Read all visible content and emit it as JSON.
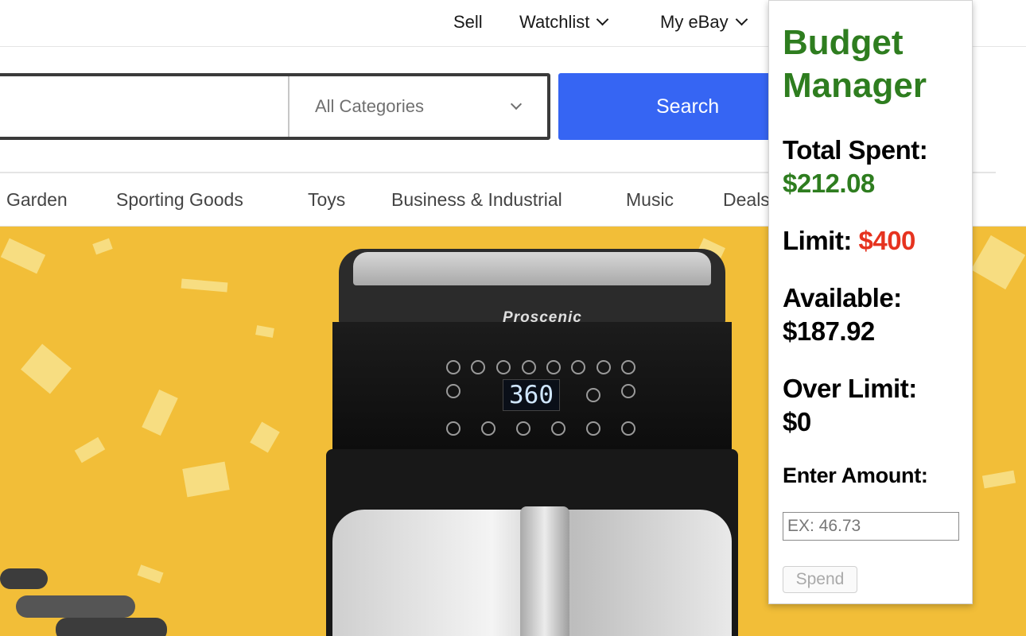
{
  "header": {
    "nav": {
      "sell": "Sell",
      "watchlist": "Watchlist",
      "my_ebay": "My eBay"
    }
  },
  "search": {
    "placeholder": "",
    "category": "All Categories",
    "button_label": "Search"
  },
  "categories": [
    "Garden",
    "Sporting Goods",
    "Toys",
    "Business & Industrial",
    "Music",
    "Deals"
  ],
  "hero": {
    "brand": "Proscenic",
    "display": "360"
  },
  "budget": {
    "title": "Budget Manager",
    "total_spent_label": "Total Spent:",
    "total_spent_value": "$212.08",
    "limit_label": "Limit:",
    "limit_value": "$400",
    "available_label": "Available:",
    "available_value": "$187.92",
    "over_limit_label": "Over Limit:",
    "over_limit_value": "$0",
    "enter_amount_label": "Enter Amount:",
    "amount_placeholder": "EX: 46.73",
    "spend_button": "Spend"
  },
  "colors": {
    "search_button": "#3665f3",
    "title_green": "#2e7d1f",
    "limit_red": "#e6331f",
    "hero_bg": "#f2be38"
  }
}
